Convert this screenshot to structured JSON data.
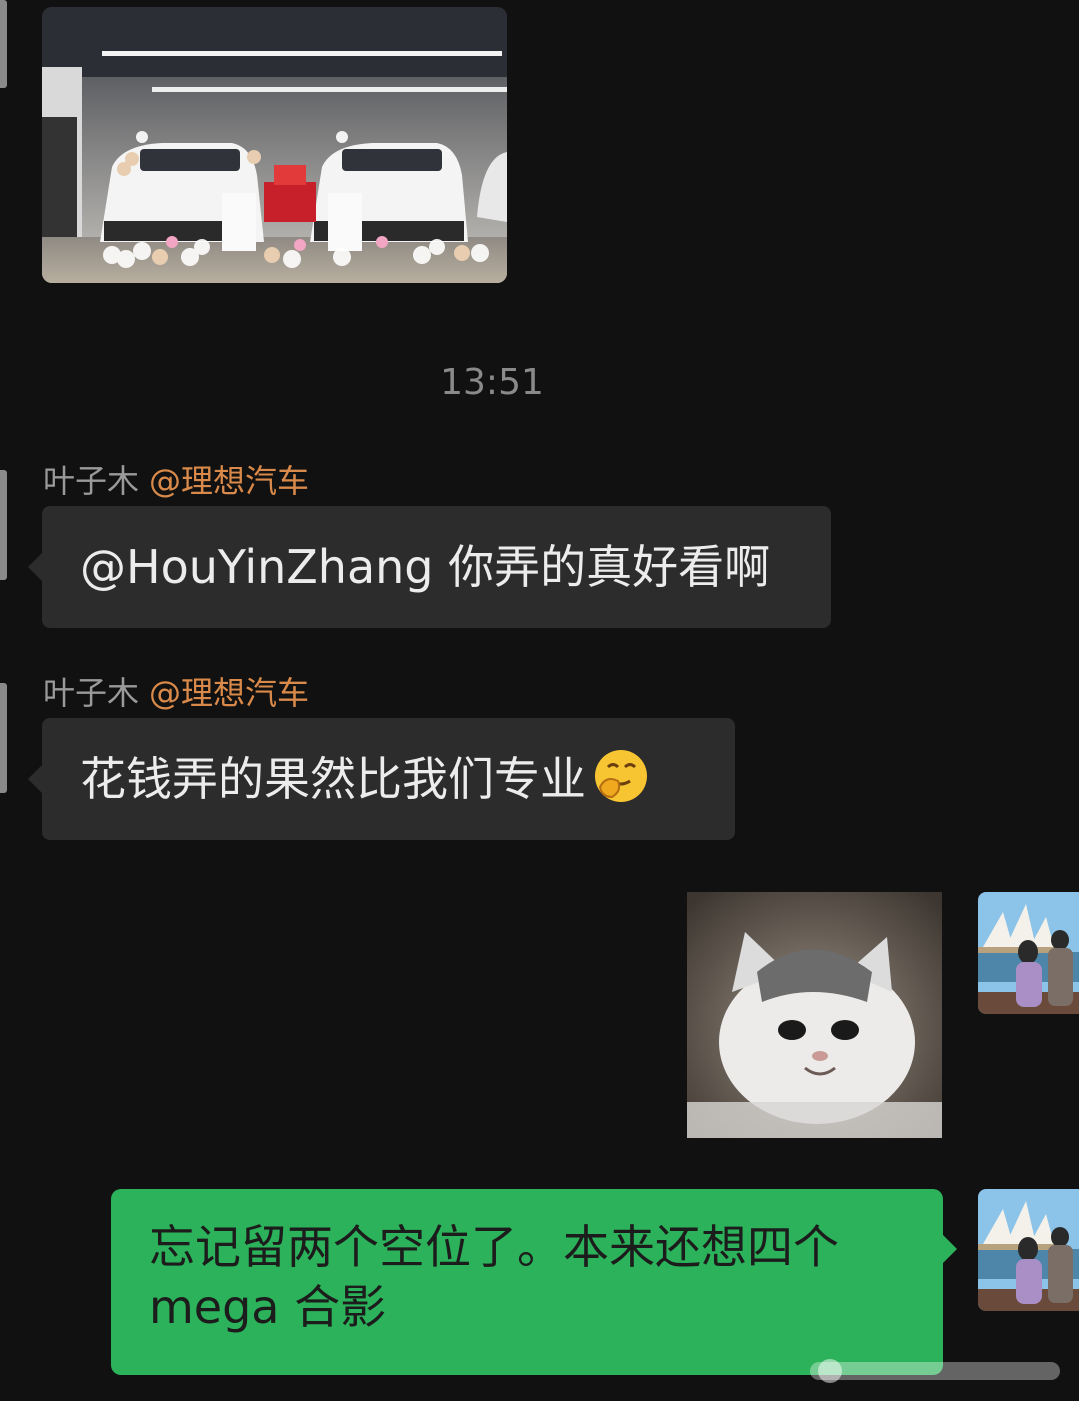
{
  "chat": {
    "timestamp": "13:51",
    "messages": [
      {
        "sender": "叶子木",
        "sender_tag": "@理想汽车",
        "text": "@HouYinZhang 你弄的真好看啊"
      },
      {
        "sender": "叶子木",
        "sender_tag": "@理想汽车",
        "text": "花钱弄的果然比我们专业"
      }
    ],
    "my_message": {
      "line1": "忘记留两个空位了。本来还想四个",
      "line2": "mega 合影"
    }
  },
  "icons": {
    "emoji": "thinking-smile-emoji",
    "photo": "car-showroom-photo",
    "sticker": "kitten-sticker",
    "avatar": "opera-house-avatar"
  },
  "colors": {
    "background": "#111111",
    "incoming_bubble": "#2c2c2c",
    "outgoing_bubble": "#2bb25a",
    "sender_tag": "#d98a4a",
    "timestamp": "#8a8a8a"
  }
}
